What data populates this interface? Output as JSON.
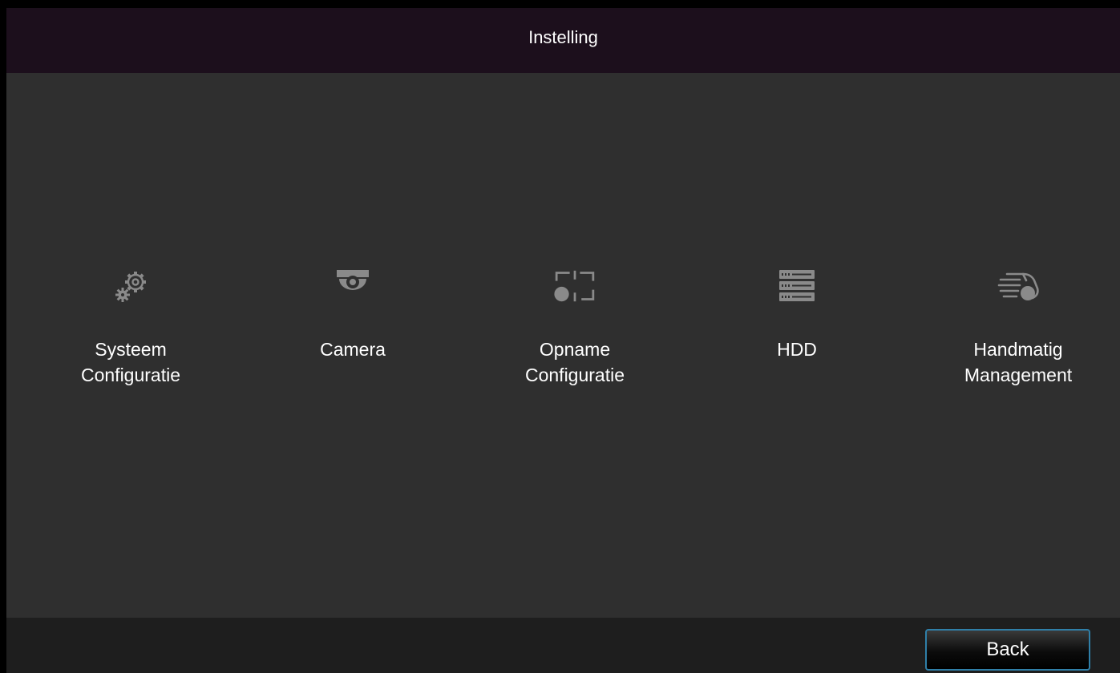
{
  "header": {
    "title": "Instelling"
  },
  "menu": {
    "items": [
      {
        "label": "Systeem\nConfiguratie",
        "icon": "gears-icon"
      },
      {
        "label": "Camera",
        "icon": "dome-camera-icon"
      },
      {
        "label": "Opname\nConfiguratie",
        "icon": "record-frame-icon"
      },
      {
        "label": "HDD",
        "icon": "hdd-stack-icon"
      },
      {
        "label": "Handmatig\nManagement",
        "icon": "hand-record-icon"
      }
    ]
  },
  "footer": {
    "back_label": "Back"
  },
  "colors": {
    "title_bar": "#1c0f1c",
    "background": "#2f2f2f",
    "bottom_bar": "#1e1e1e",
    "icon_gray": "#8a8a8a",
    "button_border": "#2f7fa8"
  }
}
